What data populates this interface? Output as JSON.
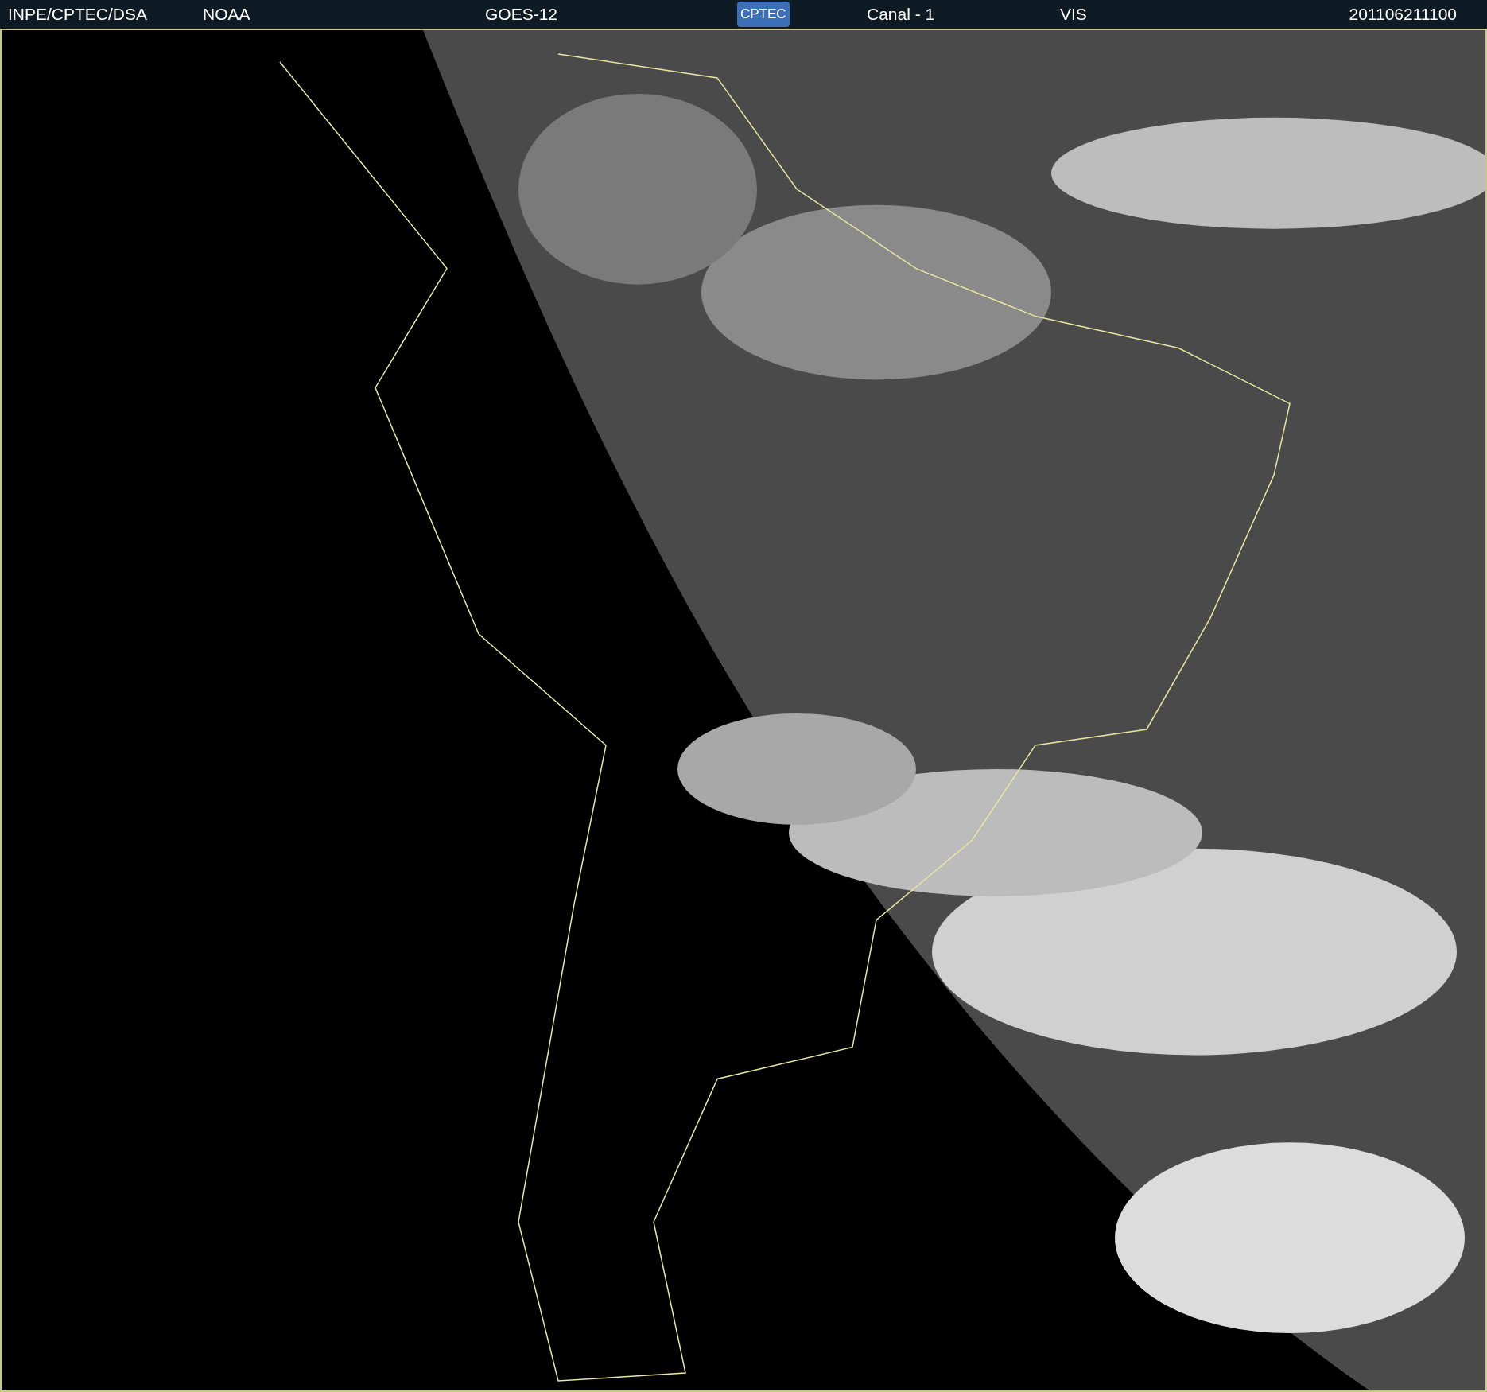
{
  "header": {
    "items": [
      {
        "kind": "text",
        "text": "INPE/CPTEC/DSA"
      },
      {
        "kind": "text",
        "text": "NOAA"
      },
      {
        "kind": "text",
        "text": "GOES-12"
      },
      {
        "kind": "logo",
        "text": "CPTEC"
      },
      {
        "kind": "text",
        "text": "Canal - 1"
      },
      {
        "kind": "text",
        "text": "VIS"
      },
      {
        "kind": "text",
        "text": "201106211100"
      }
    ]
  }
}
